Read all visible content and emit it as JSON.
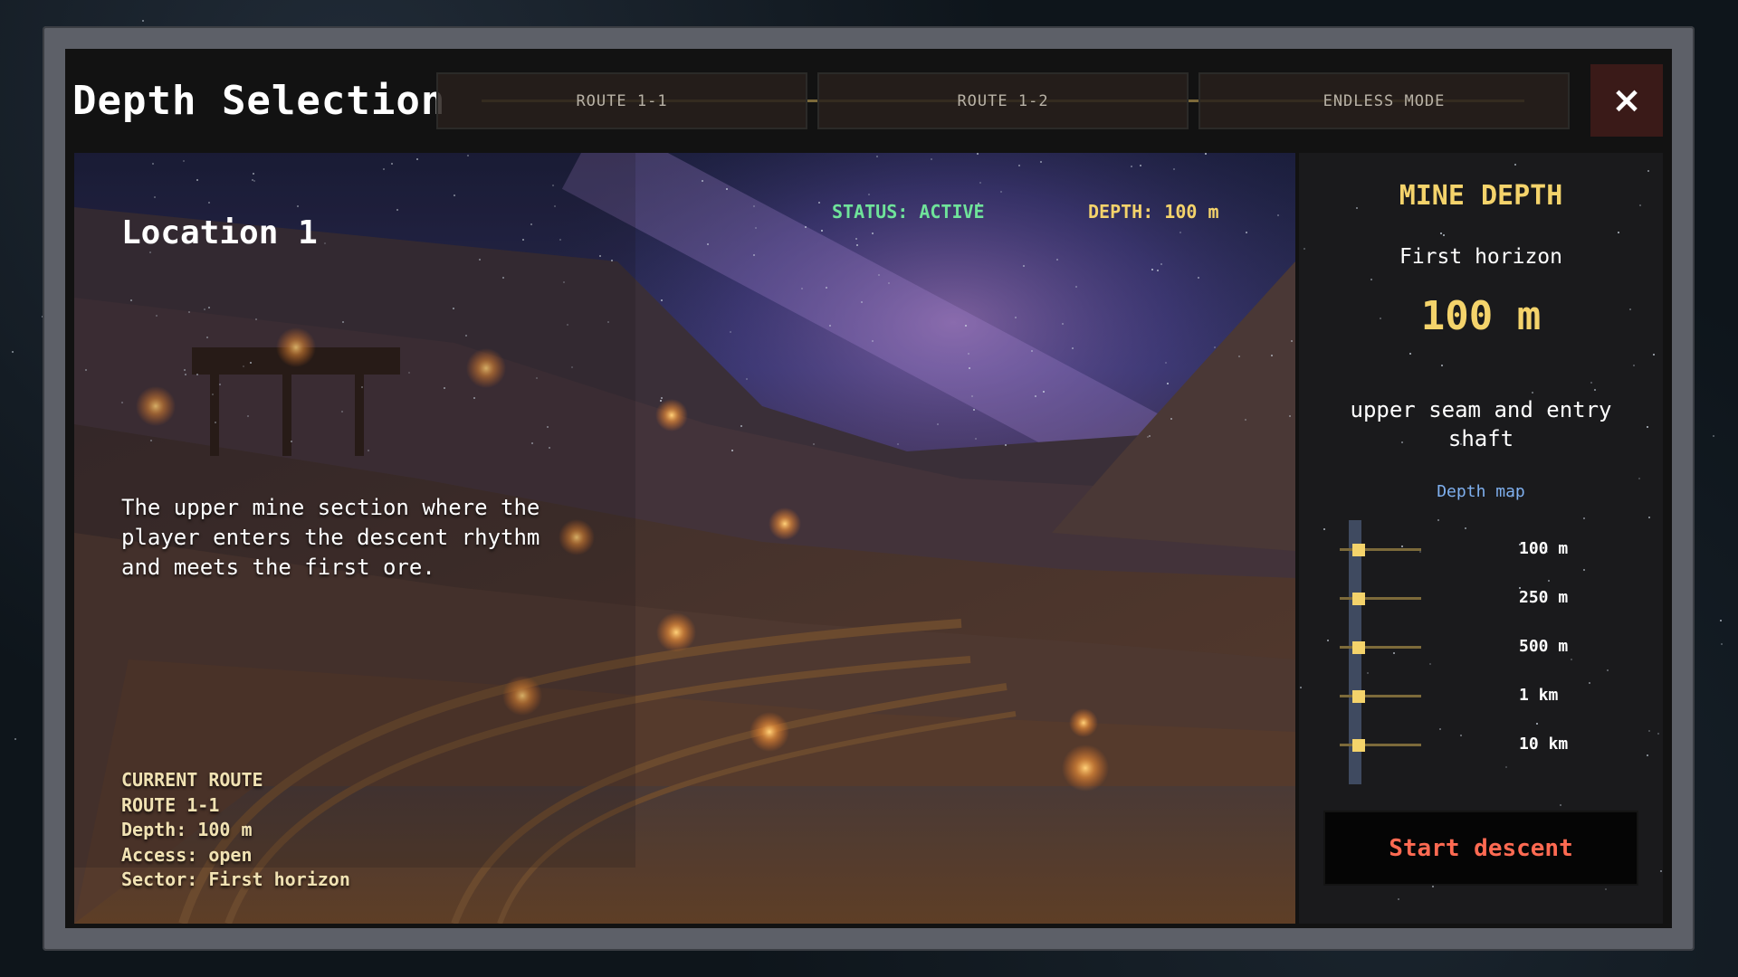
{
  "header": {
    "title": "Depth Selection",
    "close_icon": "×"
  },
  "tabs": [
    {
      "label": "ROUTE 1-1",
      "active": true
    },
    {
      "label": "ROUTE 1-2",
      "active": false
    },
    {
      "label": "ENDLESS MODE",
      "active": false
    }
  ],
  "location": {
    "title": "Location 1",
    "status": "STATUS: ACTIVE",
    "depth": "DEPTH: 100 m",
    "description": "The upper mine section where the player enters the descent rhythm and meets the first ore.",
    "route_info": [
      "CURRENT ROUTE",
      "ROUTE 1-1",
      "Depth: 100 m",
      "Access: open",
      "Sector: First horizon"
    ]
  },
  "panel": {
    "heading": "MINE DEPTH",
    "horizon": "First horizon",
    "depth_value": "100 m",
    "description": "upper seam and entry shaft",
    "map_label": "Depth map",
    "depth_levels": [
      "100 m",
      "250 m",
      "500 m",
      "1 km",
      "10 km"
    ],
    "start_label": "Start descent"
  },
  "colors": {
    "accent_gold": "#c9a44f",
    "status_green": "#6fe39a",
    "depth_yellow": "#f4d36b",
    "start_red": "#ff6a52",
    "map_blue": "#7fb0ef"
  },
  "icons": {
    "close": "close-icon",
    "depth_marker": "square-marker-icon"
  }
}
